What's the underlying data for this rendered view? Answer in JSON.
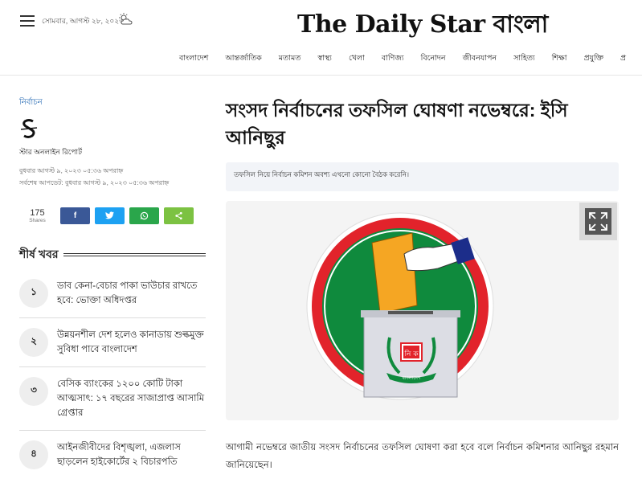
{
  "header": {
    "date": "সোমবার, আগস্ট ২৮, ২০২৩",
    "logo_en": "The Daily Star",
    "logo_bn": "বাংলা",
    "nav": [
      "বাংলাদেশ",
      "আন্তর্জাতিক",
      "মতামত",
      "স্বাস্থ্য",
      "খেলা",
      "বাণিজ্য",
      "বিনোদন",
      "জীবনযাপন",
      "সাহিত্য",
      "শিক্ষা",
      "প্রযুক্তি",
      "প্র"
    ]
  },
  "article": {
    "section": "নির্বাচন",
    "author": "স্টার অনলাইন রিপোর্ট",
    "published": "বুধবার আগস্ট ৯, ২০২৩ ০৫:৩৬ অপরাহ্ন",
    "updated": "সর্বশেষ আপডেট: বুধবার আগস্ট ৯, ২০২৩ ০৫:৩৬ অপরাহ্ন",
    "share_count": "175",
    "share_label": "Shares",
    "headline": "সংসদ নির্বাচনের তফসিল ঘোষণা নভেম্বরে: ইসি আনিছুর",
    "summary": "তফসিল নিয়ে নির্বাচন কমিশন অবশ্য এখনো কোনো বৈঠক করেনি।",
    "body": "আগামী নভেম্বরে জাতীয় সংসদ নির্বাচনের তফসিল ঘোষণা করা হবে বলে নির্বাচন কমিশনার আনিছুর রহমান জানিয়েছেন।",
    "emblem_text_box": "নি ক",
    "emblem_text_ribbon": "বাংলাদেশ"
  },
  "sidebar": {
    "top_news_title": "শীর্ষ খবর",
    "items": [
      {
        "num": "১",
        "text": "ডাব কেনা-বেচার পাকা ভাউচার রাখতে হবে: ভোক্তা অধিদপ্তর"
      },
      {
        "num": "২",
        "text": "উন্নয়নশীল দেশ হলেও কানাডায় শুল্কমুক্ত সুবিধা পাবে বাংলাদেশ"
      },
      {
        "num": "৩",
        "text": "বেসিক ব্যাংকের ১২০০ কোটি টাকা আত্মসাৎ: ১৭ বছরের সাজাপ্রাপ্ত আসামি গ্রেপ্তার"
      },
      {
        "num": "৪",
        "text": "আইনজীবীদের বিশৃঙ্খলা, এজলাস ছাড়লেন হাইকোর্টের ২ বিচারপতি"
      }
    ]
  },
  "colors": {
    "accent_link": "#2a6db5",
    "facebook": "#3a5897",
    "twitter": "#1da1f2",
    "whatsapp": "#2aa64b",
    "share": "#7cc242",
    "emblem_green": "#0f8a3d",
    "emblem_red": "#e2232b"
  },
  "icons": [
    "hamburger-icon",
    "weather-icon",
    "facebook-icon",
    "twitter-icon",
    "whatsapp-icon",
    "share-icon",
    "expand-icon"
  ]
}
